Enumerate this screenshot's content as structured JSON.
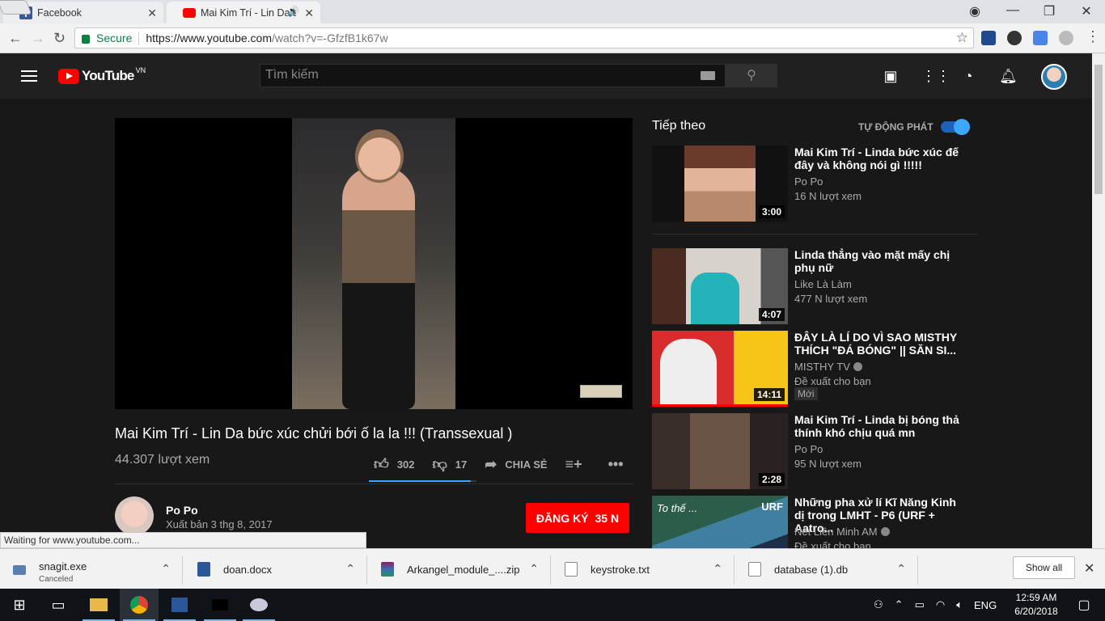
{
  "browser": {
    "tabs": [
      {
        "title": "Facebook",
        "favicon": "facebook-icon",
        "color": "#3b5998"
      },
      {
        "title": "Mai Kim Trí - Lin Da b",
        "favicon": "youtube-icon",
        "color": "#ff0000"
      }
    ],
    "secure_label": "Secure",
    "url_host": "https://www.youtube.com",
    "url_path": "/watch?v=-GfzfB1k67w"
  },
  "youtube": {
    "logo_text": "YouTube",
    "logo_region": "VN",
    "search_placeholder": "Tìm kiếm",
    "video": {
      "title": "Mai Kim Trí - Lin Da bức xúc chửi bới ố la la !!! (Transsexual )",
      "views": "44.307 lượt xem",
      "likes": "302",
      "dislikes": "17",
      "share_label": "CHIA SẺ",
      "like_ratio": 0.947
    },
    "channel": {
      "name": "Po Po",
      "published": "Xuất bản 3 thg 8, 2017",
      "subscribe_label": "ĐĂNG KÝ",
      "subscriber_count": "35 N"
    },
    "sidebar": {
      "up_next": "Tiếp theo",
      "autoplay_label": "TỰ ĐỘNG PHÁT",
      "items": [
        {
          "title": "Mai Kim Trí - Linda bức xúc đế đây và không nói gì !!!!!",
          "channel": "Po Po",
          "views": "16 N lượt xem",
          "duration": "3:00"
        },
        {
          "title": "Linda thẳng vào mặt mấy chị phụ nữ",
          "channel": "Like Là Làm",
          "views": "477 N lượt xem",
          "duration": "4:07"
        },
        {
          "title": "ĐÂY LÀ LÍ DO VÌ SAO MISTHY THÍCH \"ĐÁ BÓNG\" || SĂN SI...",
          "channel": "MISTHY TV",
          "views": "Đề xuất cho bạn",
          "duration": "14:11",
          "badge": "Mới"
        },
        {
          "title": "Mai Kim Trí - Linda bị bóng thả thính khó chịu quá mn",
          "channel": "Po Po",
          "views": "95 N lượt xem",
          "duration": "2:28"
        },
        {
          "title": "Những pha xử lí Kĩ Năng Kinh dị trong LMHT - P6 (URF + Aatro...",
          "channel": "Net Liên Minh AM",
          "views": "Đề xuất cho bạn",
          "thumb_text_left": "To thế ...",
          "thumb_text_right": "URF"
        }
      ]
    }
  },
  "status_text": "Waiting for www.youtube.com...",
  "downloads": [
    {
      "name": "snagit.exe",
      "status": "Canceled",
      "icon": "exe-file-icon"
    },
    {
      "name": "doan.docx",
      "status": "",
      "icon": "word-file-icon"
    },
    {
      "name": "Arkangel_module_....zip",
      "status": "",
      "icon": "zip-file-icon"
    },
    {
      "name": "keystroke.txt",
      "status": "",
      "icon": "text-file-icon"
    },
    {
      "name": "database (1).db",
      "status": "",
      "icon": "db-file-icon"
    }
  ],
  "show_all_label": "Show all",
  "taskbar": {
    "language": "ENG",
    "time": "12:59 AM",
    "date": "6/20/2018"
  }
}
